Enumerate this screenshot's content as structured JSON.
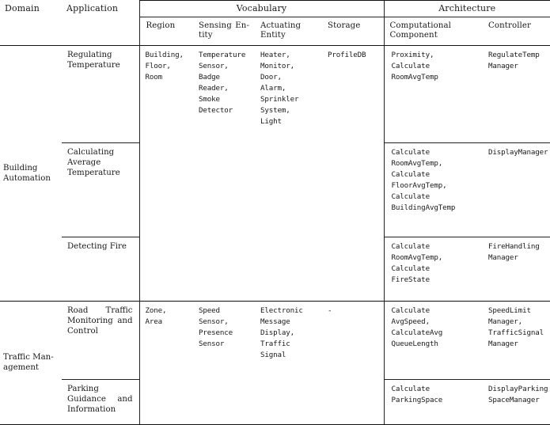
{
  "table": {
    "group_headers": [
      {
        "label": "Domain",
        "span": 1
      },
      {
        "label": "Application",
        "span": 1
      },
      {
        "label": "Vocabulary",
        "span": 4
      },
      {
        "label": "Architecture",
        "span": 2
      }
    ],
    "column_headers": [
      "Region",
      "Sensing En-\ntity",
      "Actuating\nEntity",
      "Storage",
      "Computational\nComponent",
      "Controller"
    ],
    "rows": [
      {
        "domain": "Building\nAutomation",
        "domain_rowspan": 3,
        "application": "Regulating\nTemperature",
        "region": "Building,\nFloor,\nRoom",
        "sensing_entity": "Temperature\nSensor,\nBadge\nReader,\nSmoke\nDetector",
        "actuating_entity": "Heater,\nMonitor,\nDoor,\nAlarm,\nSprinkler\nSystem,\nLight",
        "storage": "ProfileDB",
        "computational_component": "Proximity,\nCalculate\nRoomAvgTemp",
        "controller": "RegulateTemp\nManager"
      },
      {
        "application": "Calculating\nAverage\nTemperature",
        "region": "",
        "sensing_entity": "",
        "actuating_entity": "",
        "storage": "",
        "computational_component": "Calculate\nRoomAvgTemp,\nCalculate\nFloorAvgTemp,\nCalculate\nBuildingAvgTemp",
        "controller": "DisplayManager"
      },
      {
        "application": "Detecting\nFire",
        "region": "",
        "sensing_entity": "",
        "actuating_entity": "",
        "storage": "",
        "computational_component": "Calculate\nRoomAvgTemp,\nCalculate\nFireState",
        "controller": "FireHandling\nManager"
      },
      {
        "domain": "Traffic Man-\nagement",
        "domain_rowspan": 2,
        "application": "Road Traffic\nMonitoring\nand Control",
        "region": "Zone,\nArea",
        "sensing_entity": "Speed\nSensor,\nPresence\nSensor",
        "actuating_entity": "Electronic\nMessage\nDisplay,\nTraffic\nSignal",
        "storage": "-",
        "computational_component": "Calculate\nAvgSpeed,\nCalculateAvg\nQueueLength",
        "controller": "SpeedLimit\nManager,\nTrafficSignal\nManager"
      },
      {
        "application": "Parking\nGuidance and\nInformation",
        "region": "",
        "sensing_entity": "",
        "actuating_entity": "",
        "storage": "",
        "computational_component": "Calculate\nParkingSpace",
        "controller": "DisplayParking\nSpaceManager"
      }
    ]
  },
  "style": {
    "rule_color": "#111111",
    "text_color": "#1a1a1a",
    "background": "#ffffff"
  }
}
